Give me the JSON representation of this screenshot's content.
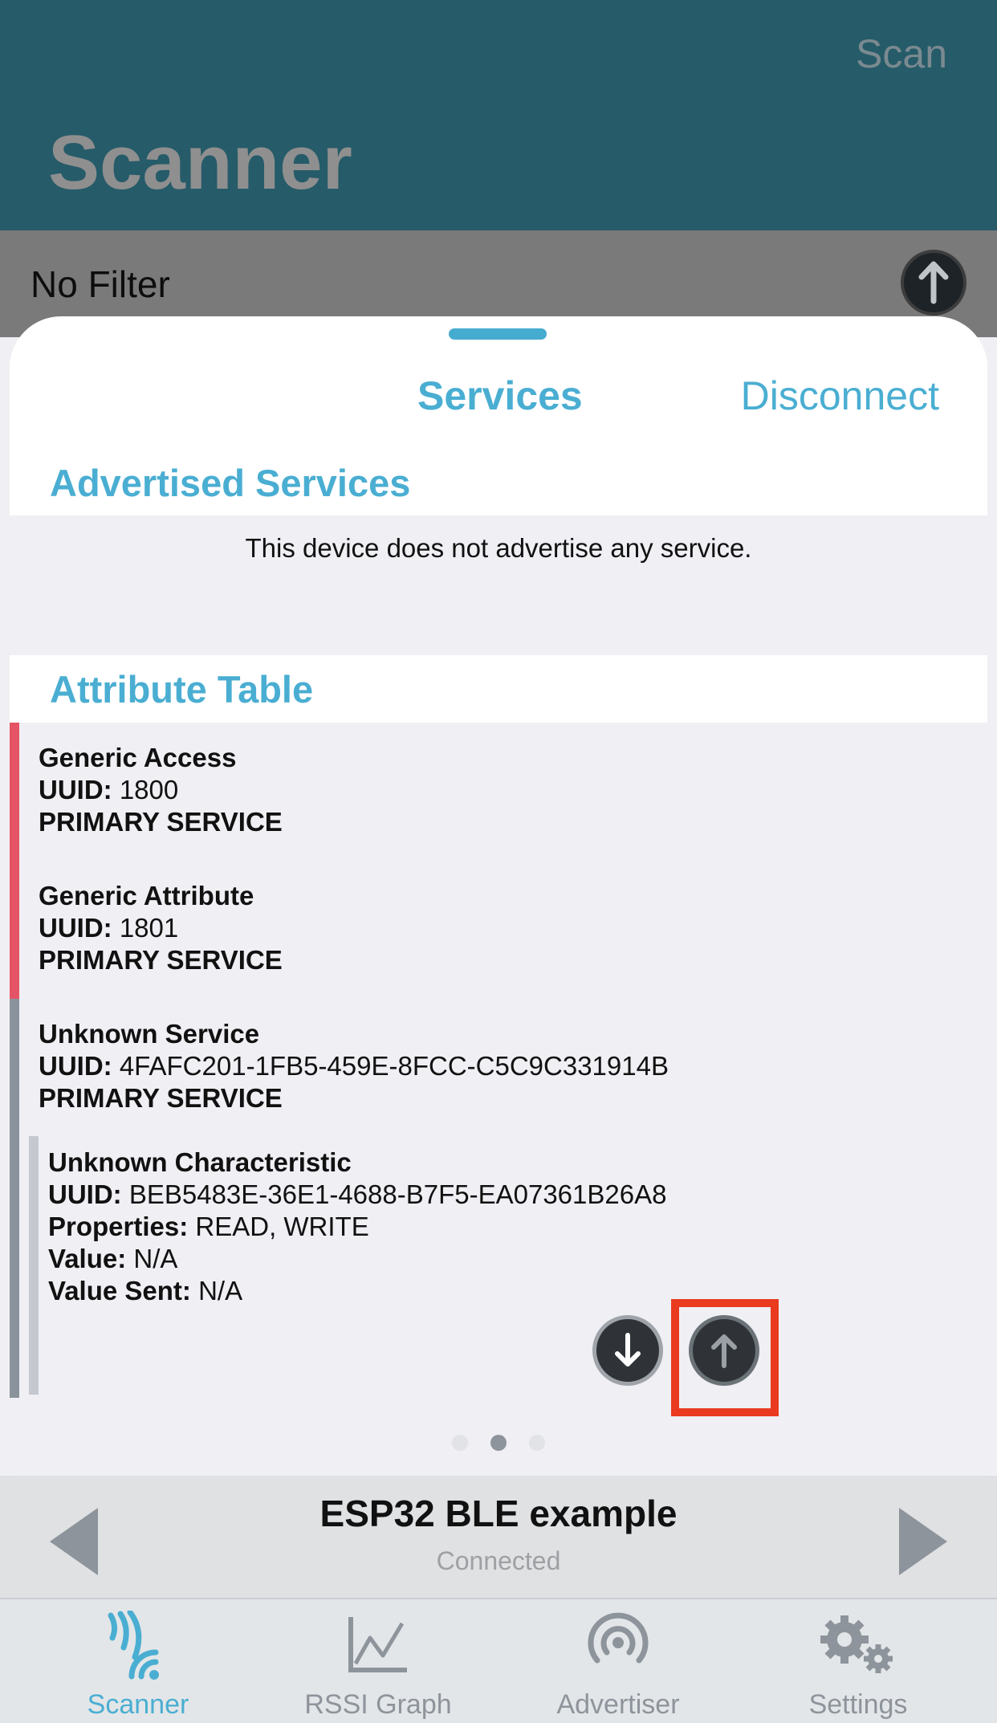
{
  "header": {
    "scan_label": "Scan",
    "title": "Scanner"
  },
  "filter": {
    "label": "No Filter"
  },
  "sheet": {
    "tab_services": "Services",
    "disconnect_label": "Disconnect",
    "advertised_title": "Advertised Services",
    "advertised_message": "This device does not advertise any service.",
    "attribute_title": "Attribute Table",
    "services": [
      {
        "name": "Generic Access",
        "uuid_label": "UUID:",
        "uuid": "1800",
        "type": "PRIMARY SERVICE"
      },
      {
        "name": "Generic Attribute",
        "uuid_label": "UUID:",
        "uuid": "1801",
        "type": "PRIMARY SERVICE"
      },
      {
        "name": "Unknown Service",
        "uuid_label": "UUID:",
        "uuid": "4FAFC201-1FB5-459E-8FCC-C5C9C331914B",
        "type": "PRIMARY SERVICE"
      }
    ],
    "characteristic": {
      "name": "Unknown Characteristic",
      "uuid_label": "UUID:",
      "uuid": "BEB5483E-36E1-4688-B7F5-EA07361B26A8",
      "properties_label": "Properties:",
      "properties": "READ, WRITE",
      "value_label": "Value:",
      "value": "N/A",
      "value_sent_label": "Value Sent:",
      "value_sent": "N/A"
    },
    "page_indicator": {
      "total": 3,
      "current": 2
    }
  },
  "device": {
    "name": "ESP32 BLE example",
    "status": "Connected"
  },
  "tabbar": [
    {
      "label": "Scanner",
      "icon": "scanner-icon",
      "active": true
    },
    {
      "label": "RSSI Graph",
      "icon": "graph-icon",
      "active": false
    },
    {
      "label": "Advertiser",
      "icon": "advertiser-icon",
      "active": false
    },
    {
      "label": "Settings",
      "icon": "gear-icon",
      "active": false
    }
  ],
  "colors": {
    "accent": "#4aaed2",
    "nav": "#265b69",
    "highlight": "#ea3a20",
    "service_bar_red": "#e55466"
  }
}
